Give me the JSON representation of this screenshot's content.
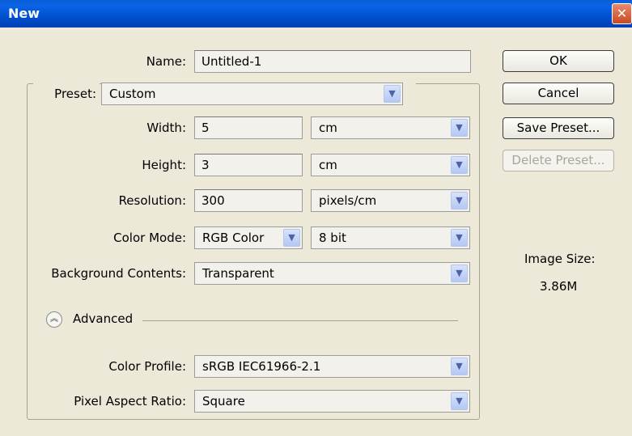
{
  "window": {
    "title": "New",
    "close_glyph": "✕"
  },
  "fields": {
    "name": {
      "label": "Name:",
      "value": "Untitled-1"
    },
    "preset": {
      "label": "Preset:",
      "value": "Custom"
    },
    "width": {
      "label": "Width:",
      "value": "5",
      "unit": "cm"
    },
    "height": {
      "label": "Height:",
      "value": "3",
      "unit": "cm"
    },
    "resolution": {
      "label": "Resolution:",
      "value": "300",
      "unit": "pixels/cm"
    },
    "color_mode": {
      "label": "Color Mode:",
      "value": "RGB Color",
      "depth": "8 bit"
    },
    "background": {
      "label": "Background Contents:",
      "value": "Transparent"
    },
    "advanced": {
      "label": "Advanced",
      "icon": "collapse-chevron-icon"
    },
    "color_profile": {
      "label": "Color Profile:",
      "value": "sRGB IEC61966-2.1"
    },
    "pixel_aspect": {
      "label": "Pixel Aspect Ratio:",
      "value": "Square"
    }
  },
  "buttons": {
    "ok": "OK",
    "cancel": "Cancel",
    "save_preset": "Save Preset...",
    "delete_preset": "Delete Preset..."
  },
  "image_size": {
    "label": "Image Size:",
    "value": "3.86M"
  },
  "icons": {
    "dropdown_arrow": "▼",
    "advanced_chevron": "︽"
  },
  "colors": {
    "titlebar": "#0054e3",
    "dialog_bg": "#ece9d8",
    "close_button": "#d9582c"
  }
}
